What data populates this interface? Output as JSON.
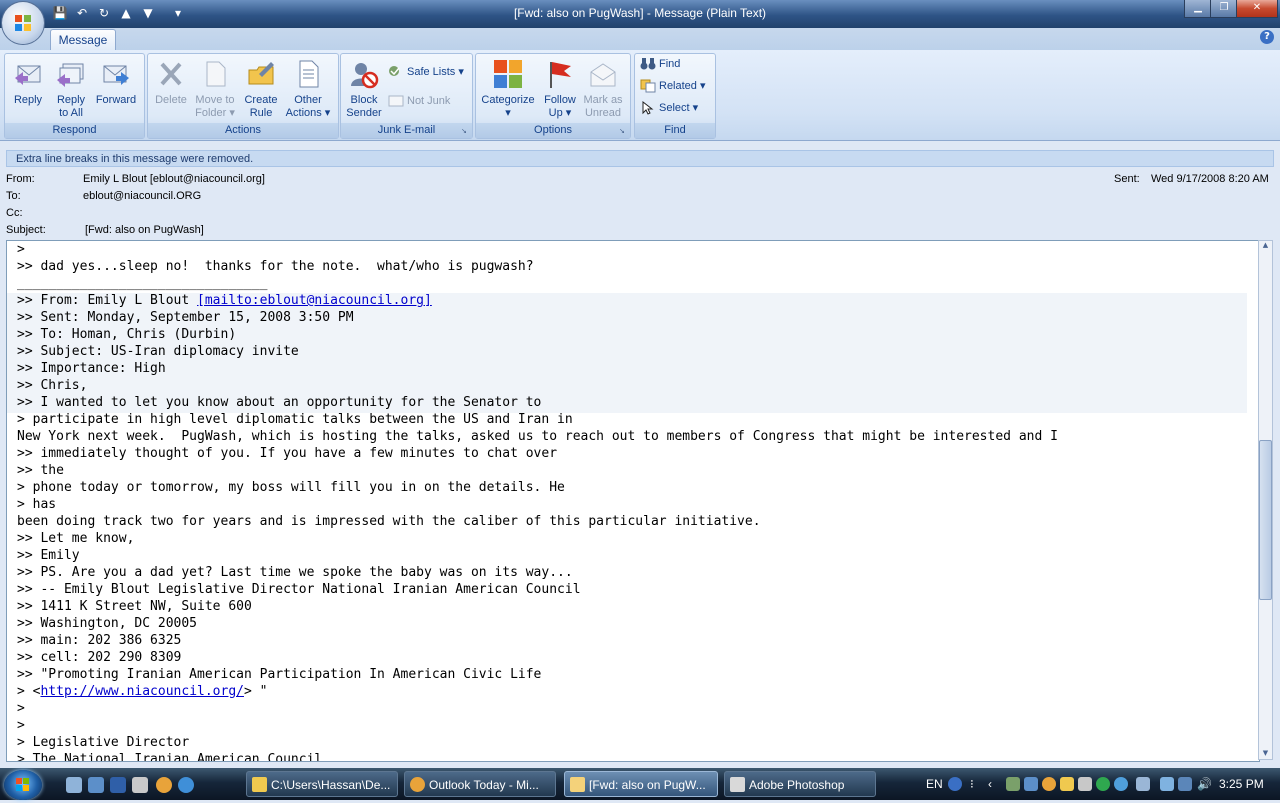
{
  "window": {
    "title": "[Fwd: also on PugWash] - Message (Plain Text)",
    "controls": [
      "▁",
      "❐",
      "✕"
    ]
  },
  "ribbon": {
    "tab": "Message",
    "groups": {
      "respond": {
        "label": "Respond",
        "reply": "Reply",
        "reply_all": "Reply\nto All",
        "forward": "Forward"
      },
      "actions": {
        "label": "Actions",
        "delete": "Delete",
        "move": "Move to\nFolder ▾",
        "create_rule": "Create\nRule",
        "other": "Other\nActions ▾"
      },
      "junk": {
        "label": "Junk E-mail",
        "block": "Block\nSender",
        "safe_lists": "Safe Lists ▾",
        "not_junk": "Not Junk"
      },
      "options": {
        "label": "Options",
        "categorize": "Categorize\n▾",
        "follow_up": "Follow\nUp ▾",
        "mark_unread": "Mark as\nUnread"
      },
      "find": {
        "label": "Find",
        "find": "Find",
        "related": "Related ▾",
        "select": "Select ▾"
      }
    }
  },
  "infobar": "Extra line breaks in this message were removed.",
  "header": {
    "from_label": "From:",
    "from": "Emily L Blout [eblout@niacouncil.org]",
    "to_label": "To:",
    "to": "eblout@niacouncil.ORG",
    "cc_label": "Cc:",
    "subject_label": "Subject:",
    "subject": "[Fwd: also on PugWash]",
    "sent_label": "Sent:",
    "sent": "Wed 9/17/2008 8:20 AM"
  },
  "body_lines": [
    ">",
    ">> dad yes...sleep no!  thanks for the note.  what/who is pugwash?",
    "________________________________",
    ">> From: Emily L Blout ",
    ">> Sent: Monday, September 15, 2008 3:50 PM",
    ">> To: Homan, Chris (Durbin)",
    ">> Subject: US-Iran diplomacy invite",
    ">> Importance: High",
    ">> Chris,",
    ">> I wanted to let you know about an opportunity for the Senator to",
    "> participate in high level diplomatic talks between the US and Iran in",
    "New York next week.  PugWash, which is hosting the talks, asked us to reach out to members of Congress that might be interested and I",
    ">> immediately thought of you. If you have a few minutes to chat over",
    ">> the",
    "> phone today or tomorrow, my boss will fill you in on the details. He",
    "> has",
    "been doing track two for years and is impressed with the caliber of this particular initiative.",
    ">> Let me know,",
    ">> Emily",
    ">> PS. Are you a dad yet? Last time we spoke the baby was on its way...",
    ">> -- Emily Blout Legislative Director National Iranian American Council",
    ">> 1411 K Street NW, Suite 600",
    ">> Washington, DC 20005",
    ">> main: 202 386 6325",
    ">> cell: 202 290 8309",
    ">> \"Promoting Iranian American Participation In American Civic Life",
    "> <",
    ">",
    ">",
    "> Legislative Director",
    "> The National Iranian American Council"
  ],
  "links": {
    "mailto": "[mailto:eblout@niacouncil.org]",
    "site": "http://www.niacouncil.org/",
    "site_after": "> \""
  },
  "taskbar": {
    "items": [
      "C:\\Users\\Hassan\\De...",
      "Outlook Today - Mi...",
      "[Fwd: also on PugW...",
      "Adobe Photoshop"
    ],
    "lang": "EN",
    "clock": "3:25 PM"
  },
  "colors": {
    "ribbon_text": "#15428b",
    "link": "#0000cc",
    "title_bar": "#2e5486"
  }
}
